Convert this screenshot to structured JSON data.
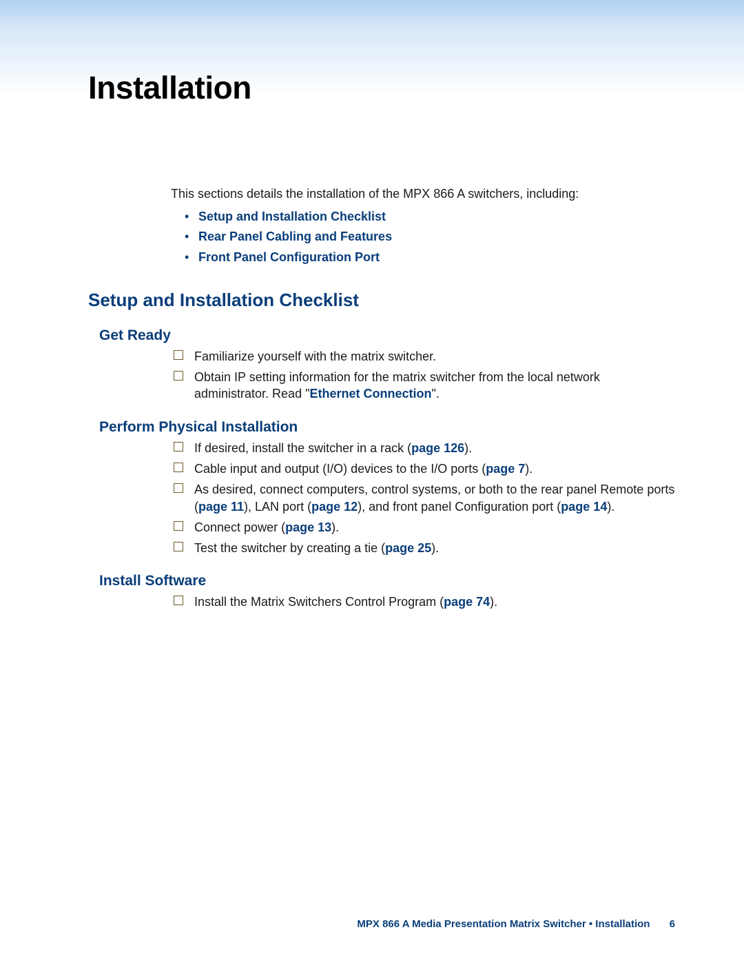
{
  "title": "Installation",
  "intro": "This sections details the installation of the MPX 866 A switchers, including:",
  "toc": [
    "Setup and Installation Checklist",
    "Rear Panel Cabling and Features",
    "Front Panel Configuration Port"
  ],
  "section_heading": "Setup and Installation Checklist",
  "sub1": {
    "heading": "Get Ready",
    "items": {
      "i0": "Familiarize yourself with the matrix switcher.",
      "i1a": "Obtain IP setting information for the matrix switcher from the local network administrator. Read \"",
      "i1link": "Ethernet Connection",
      "i1b": "\"."
    }
  },
  "sub2": {
    "heading": "Perform Physical Installation",
    "items": {
      "i0a": "If desired, install the switcher in a rack (",
      "i0link": "page 126",
      "i0b": ").",
      "i1a": "Cable input and output (I/O) devices to the I/O ports (",
      "i1link": "page 7",
      "i1b": ").",
      "i2a": "As desired, connect computers, control systems, or both to the rear panel Remote ports (",
      "i2l1": "page 11",
      "i2m1": "), LAN port (",
      "i2l2": "page 12",
      "i2m2": "), and front panel Configuration port (",
      "i2l3": "page 14",
      "i2b": ").",
      "i3a": "Connect power (",
      "i3link": "page 13",
      "i3b": ").",
      "i4a": "Test the switcher by creating a tie (",
      "i4link": "page 25",
      "i4b": ")."
    }
  },
  "sub3": {
    "heading": "Install Software",
    "items": {
      "i0a": "Install the Matrix Switchers Control Program (",
      "i0link": "page 74",
      "i0b": ")."
    }
  },
  "footer": {
    "text": "MPX 866 A Media Presentation Matrix Switcher • Installation",
    "page": "6"
  }
}
